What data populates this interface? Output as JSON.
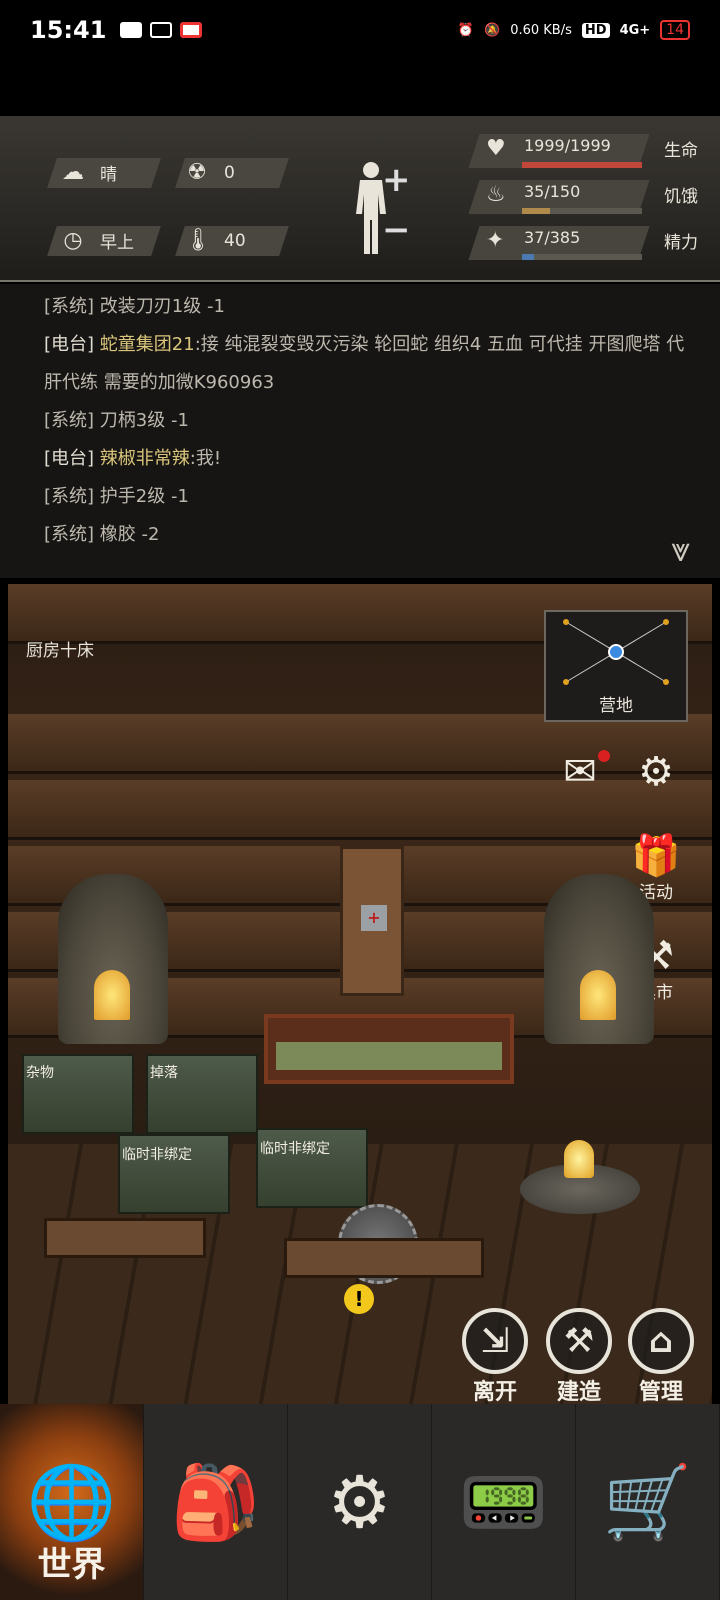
{
  "status_bar": {
    "time": "15:41",
    "network_speed": "0.60 KB/s",
    "hd": "HD",
    "signal": "4G+",
    "battery": "14"
  },
  "hud": {
    "weather": {
      "icon": "cloud-sun-icon",
      "value": "晴"
    },
    "radiation": {
      "icon": "radiation-icon",
      "value": "0"
    },
    "time_of_day": {
      "icon": "clock-icon",
      "value": "早上"
    },
    "temperature": {
      "icon": "thermometer-icon",
      "value": "40"
    },
    "stats": [
      {
        "icon": "heart-icon",
        "value": "1999/1999",
        "label": "生命",
        "fraction": 1.0,
        "color": "#c0473a"
      },
      {
        "icon": "stomach-icon",
        "value": "35/150",
        "label": "饥饿",
        "fraction": 0.233,
        "color": "#b08a4a"
      },
      {
        "icon": "brain-icon",
        "value": "37/385",
        "label": "精力",
        "fraction": 0.096,
        "color": "#4a7ab0"
      }
    ]
  },
  "chat": {
    "messages": [
      {
        "tag": "[系统]",
        "name": "",
        "text": "改装刀刃1级 -1"
      },
      {
        "tag": "[电台]",
        "name": "蛇童集团21",
        "text": ":接 纯混裂变毁灭污染 轮回蛇 组织4 五血 可代挂 开图爬塔 代肝代练 需要的加微K960963"
      },
      {
        "tag": "[系统]",
        "name": "",
        "text": "刀柄3级 -1"
      },
      {
        "tag": "[电台]",
        "name": "辣椒非常辣",
        "text": ":我!"
      },
      {
        "tag": "[系统]",
        "name": "",
        "text": "护手2级 -1"
      },
      {
        "tag": "[系统]",
        "name": "",
        "text": "橡胶 -2"
      }
    ],
    "collapse_icon": "chevron-down-icon"
  },
  "scene": {
    "room_title": "厨房十床",
    "minimap_label": "营地",
    "side_buttons": [
      {
        "name": "mail",
        "label": ""
      },
      {
        "name": "settings",
        "label": ""
      },
      {
        "name": "events",
        "label": "活动"
      },
      {
        "name": "black-market",
        "label": "黑市"
      }
    ],
    "crates": [
      "杂物",
      "掉落",
      "临时非绑定",
      "临时非绑定"
    ],
    "actions": [
      {
        "name": "leave",
        "label": "离开"
      },
      {
        "name": "build",
        "label": "建造"
      },
      {
        "name": "manage",
        "label": "管理"
      }
    ]
  },
  "nav": {
    "items": [
      {
        "name": "world",
        "label": "世界",
        "icon": "globe-icon",
        "active": true
      },
      {
        "name": "backpack",
        "label": "",
        "icon": "backpack-icon"
      },
      {
        "name": "skills",
        "label": "",
        "icon": "head-gears-icon"
      },
      {
        "name": "radio",
        "label": "",
        "icon": "walkie-talkie-icon"
      },
      {
        "name": "shop",
        "label": "",
        "icon": "cart-icon"
      }
    ]
  }
}
